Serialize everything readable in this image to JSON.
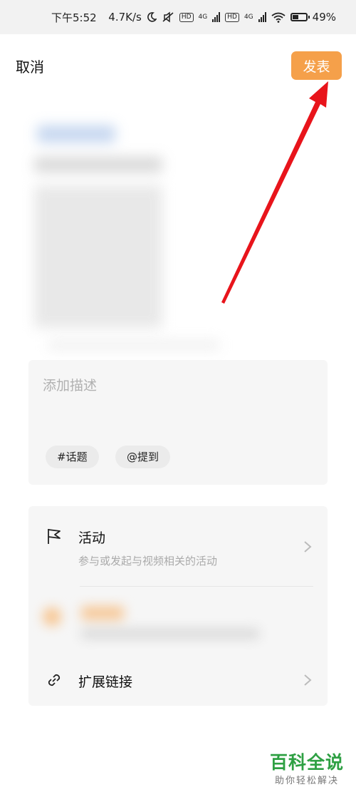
{
  "status_bar": {
    "time": "下午5:52",
    "network_speed": "4.7K/s",
    "hd_label": "HD",
    "net_label_1": "4G",
    "net_label_2": "4G",
    "battery": "49%",
    "battery_level": 0.49,
    "icons": [
      "moon-icon",
      "mute-icon",
      "signal-icon",
      "wifi-icon",
      "battery-icon"
    ]
  },
  "header": {
    "cancel_label": "取消",
    "publish_label": "发表",
    "publish_color": "#f5a04a"
  },
  "description": {
    "placeholder": "添加描述",
    "value": "",
    "chips": [
      "#话题",
      "@提到"
    ]
  },
  "options": {
    "activity": {
      "title": "活动",
      "subtitle": "参与或发起与视频相关的活动",
      "icon": "flag-icon"
    },
    "link": {
      "title": "扩展链接",
      "icon": "link-icon"
    }
  },
  "watermark": {
    "title": "百科全说",
    "subtitle": "助你轻松解决"
  },
  "annotation_color": "#e8141b"
}
